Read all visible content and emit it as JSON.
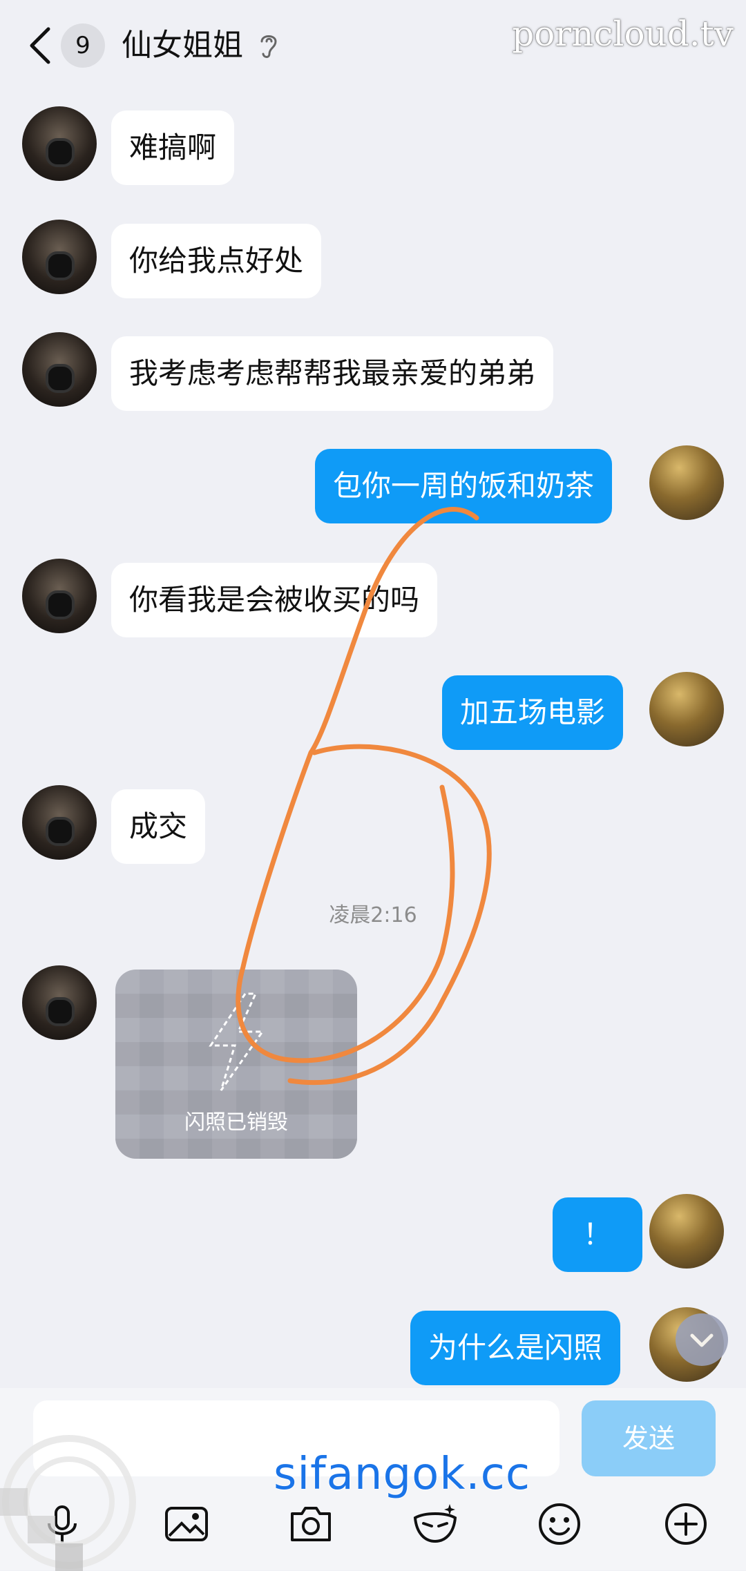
{
  "header": {
    "back_icon": "chevron-left-icon",
    "unread_count": "9",
    "contact_name": "仙女姐姐",
    "mode_icon": "ear-icon",
    "watermark": "porncloud.tv"
  },
  "messages": [
    {
      "side": "in",
      "text": "难搞啊"
    },
    {
      "side": "in",
      "text": "你给我点好处"
    },
    {
      "side": "in",
      "text": "我考虑考虑帮帮我最亲爱的弟弟"
    },
    {
      "side": "out",
      "text": "包你一周的饭和奶茶"
    },
    {
      "side": "in",
      "text": "你看我是会被收买的吗"
    },
    {
      "side": "out",
      "text": "加五场电影"
    },
    {
      "side": "in",
      "text": "成交"
    },
    {
      "side": "time",
      "text": "凌晨2:16"
    },
    {
      "side": "in",
      "type": "flash",
      "text": "闪照已销毁"
    },
    {
      "side": "out",
      "text": "！"
    },
    {
      "side": "out",
      "text": "为什么是闪照"
    }
  ],
  "input": {
    "placeholder": "",
    "send_label": "发送",
    "toolbar": [
      "microphone-icon",
      "image-icon",
      "camera-icon",
      "mask-icon",
      "emoji-icon",
      "plus-icon"
    ]
  },
  "watermark_bottom": "sifangok.cc",
  "colors": {
    "background": "#eff0f5",
    "outgoing_bubble": "#0f9bf7",
    "incoming_bubble": "#ffffff",
    "send_button": "#8bcdf8",
    "annotation_stroke": "#f0883e"
  }
}
